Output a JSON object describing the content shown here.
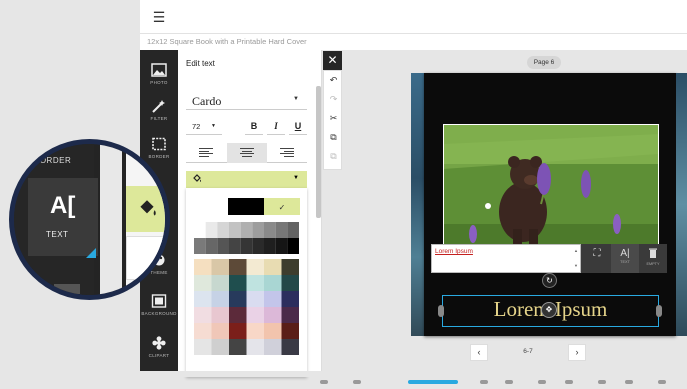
{
  "app": {
    "menu_icon": "hamburger-icon",
    "subtitle": "12x12 Square Book with a Printable Hard Cover"
  },
  "toolbar": {
    "items": [
      {
        "label": "PHOTO",
        "icon": "photo-icon"
      },
      {
        "label": "FILTER",
        "icon": "magic-wand-icon"
      },
      {
        "label": "BORDER",
        "icon": "border-icon"
      },
      {
        "label": "TEXT",
        "icon": "text-icon"
      },
      {
        "label": "THEME",
        "icon": "theme-icon"
      },
      {
        "label": "BACKGROUND",
        "icon": "background-icon"
      },
      {
        "label": "CLIPART",
        "icon": "clipart-icon"
      }
    ]
  },
  "panel": {
    "title": "Edit text",
    "font": "Cardo",
    "size": "72",
    "bold": "B",
    "italic": "I",
    "underline": "U",
    "fill_accent": "#dde89a",
    "palette": {
      "top_row": [
        "#ffffff",
        "#000000",
        "#dde89a"
      ],
      "selected_mark": "✓",
      "grays": [
        [
          "#ffffff",
          "#e9e9e9",
          "#d5d5d5",
          "#c2c2c2",
          "#b0b0b0",
          "#9d9d9d",
          "#8a8a8a",
          "#777777",
          "#636363"
        ],
        [
          "#7a7a7a",
          "#676767",
          "#555555",
          "#444444",
          "#353535",
          "#2a2a2a",
          "#1f1f1f",
          "#151515",
          "#000000"
        ]
      ],
      "colors": [
        [
          "#f5dfc0",
          "#d9c7a7",
          "#5d4a38",
          "#f3ead2",
          "#e8dcb2",
          "#3d3d2d"
        ],
        [
          "#dfe8dc",
          "#c7d8cf",
          "#1f4e4e",
          "#bfe3e0",
          "#a9d6d3",
          "#234848"
        ],
        [
          "#dce4ef",
          "#c6d2e6",
          "#273a5c",
          "#d9dcf0",
          "#c3c5ea",
          "#2c2e5e"
        ],
        [
          "#f1dde2",
          "#e8c7d0",
          "#5c2a3a",
          "#ead2e6",
          "#dcb8d8",
          "#4b2a4a"
        ],
        [
          "#f6dcd2",
          "#f0c7b8",
          "#7b1f1a",
          "#f8d7c7",
          "#f2c4ad",
          "#5a1e18"
        ],
        [
          "#e5e5e5",
          "#cfcfcf",
          "#444444",
          "#e4e4ea",
          "#d0d0da",
          "#3a3a45"
        ]
      ]
    }
  },
  "actions": [
    {
      "icon": "undo-icon",
      "glyph": "↶"
    },
    {
      "icon": "redo-icon",
      "glyph": "↷"
    },
    {
      "icon": "cut-icon",
      "glyph": "✂"
    },
    {
      "icon": "copy-icon",
      "glyph": "⧉"
    },
    {
      "icon": "paste-icon",
      "glyph": "⧉"
    }
  ],
  "canvas": {
    "page_label": "Page 6",
    "editor_text": "Lorem Ipsum",
    "title_text": "Lorem Ipsum",
    "ctx_tools": [
      {
        "label": "",
        "icon": "crop-icon",
        "glyph": "⛶"
      },
      {
        "label": "TEXT",
        "icon": "text-icon",
        "glyph": "A|"
      },
      {
        "label": "EMPTY",
        "icon": "trash-icon",
        "glyph": "🗑"
      }
    ],
    "spread": "6-7",
    "prev": "‹",
    "next": "›"
  },
  "magnifier": {
    "top_label": "BORDER",
    "text_label": "TEXT"
  }
}
